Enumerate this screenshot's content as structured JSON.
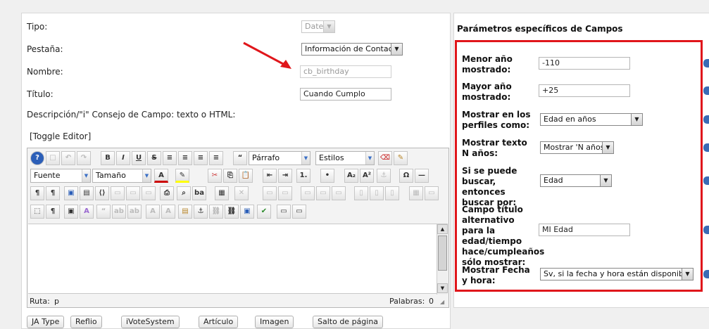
{
  "form": {
    "tipo": {
      "label": "Tipo:",
      "value": "Date"
    },
    "pestana": {
      "label": "Pestaña:",
      "value": "Información de Contacto"
    },
    "nombre": {
      "label": "Nombre:",
      "value": "cb_birthday"
    },
    "titulo": {
      "label": "Título:",
      "value": "Cuando Cumplo"
    },
    "descripcion": {
      "label": "Descripción/\"i\" Consejo de Campo: texto o HTML:"
    },
    "toggle_editor": "[Toggle Editor]"
  },
  "editor": {
    "format_combo": "Párrafo",
    "styles_combo": "Estilos",
    "font_combo": "Fuente",
    "size_combo": "Tamaño",
    "path_label": "Ruta:",
    "path_value": "p",
    "word_count_label": "Palabras:",
    "word_count_value": "0"
  },
  "bottom_buttons": [
    "JA Type",
    "Reflio",
    "iVoteSystem",
    "Artículo",
    "Imagen",
    "Salto de página"
  ],
  "params": {
    "title": "Parámetros específicos de Campos",
    "rows": [
      {
        "label": "Menor año mostrado:",
        "value": "-110"
      },
      {
        "label": "Mayor año mostrado:",
        "value": "+25"
      },
      {
        "label": "Mostrar en los perfiles como:",
        "value": "Edad en años"
      },
      {
        "label": "Mostrar texto N años:",
        "value": "Mostrar 'N años'"
      },
      {
        "label": "Si se puede buscar, entonces buscar por:",
        "value": "Edad"
      },
      {
        "label": "Campo título alternativo para la edad/tiempo hace/cumpleaños sólo mostrar:",
        "value": "MI Edad"
      },
      {
        "label": "Mostrar Fecha y hora:",
        "value": "Sv, si la fecha y hora están disponibles"
      }
    ]
  },
  "colors": {
    "highlight_box": "#e0161b",
    "arrow": "#e0161b"
  }
}
